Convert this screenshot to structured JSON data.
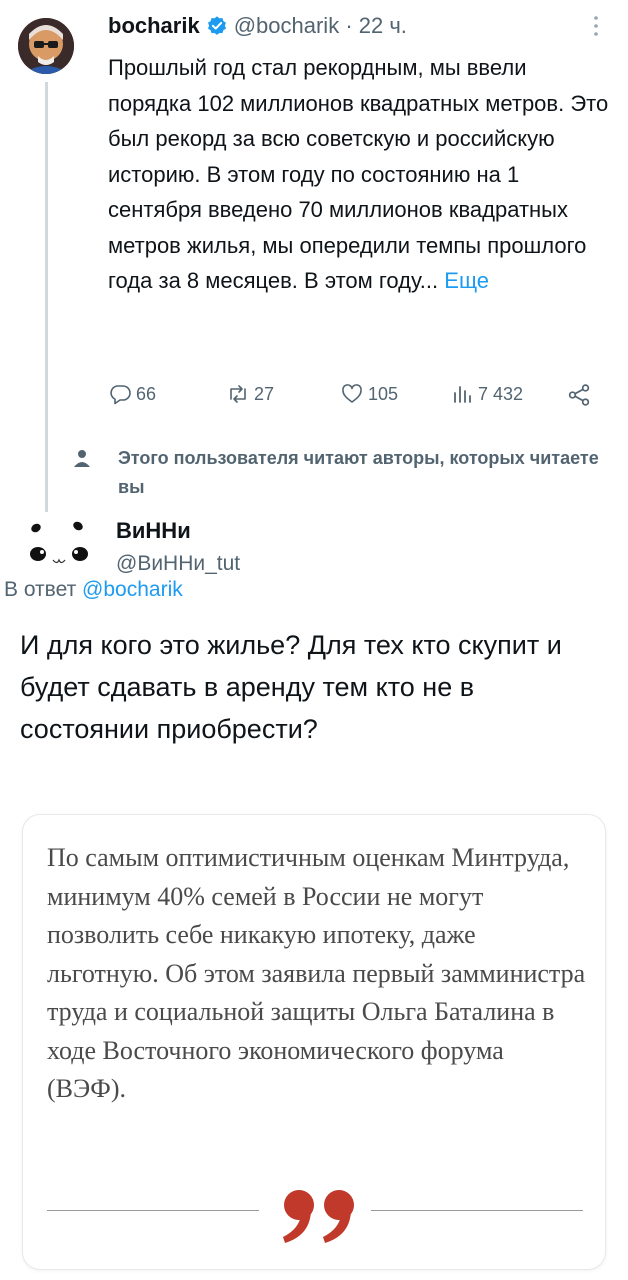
{
  "tweet": {
    "author_name": "bocharik",
    "handle": "@bocharik",
    "separator": " · ",
    "time": "22 ч.",
    "text": "Прошлый год стал рекордным, мы ввели порядка 102 миллионов квадратных метров. Это был рекорд за всю советскую и российскую историю. В этом году по состоянию на 1 сентября введено 70 миллионов квадратных метров жилья, мы опередили темпы прошлого года за 8 месяцев. В этом году...",
    "more_label": "Еще",
    "stats": {
      "replies": "66",
      "retweets": "27",
      "likes": "105",
      "views": "7 432"
    }
  },
  "social_context": "Этого пользователя читают авторы, которых читаете вы",
  "reply": {
    "author_name": "ВиННи",
    "handle": "@ВиННи_tut",
    "reply_prefix": "В ответ ",
    "reply_mention": "@bocharik",
    "text": "И для кого это жилье? Для тех кто скупит и будет сдавать в аренду тем кто не в состоянии приобрести?"
  },
  "quote_card": {
    "text": "По самым оптимистичным оценкам Минтруда, минимум 40% семей в России не могут позволить себе никакую ипотеку, даже льготную. Об этом заявила первый замминистра труда и социальной защиты Ольга Баталина в ходе Восточного экономического форума (ВЭФ).",
    "accent_color": "#c0392b"
  },
  "colors": {
    "link": "#1d9bf0",
    "secondary_text": "#536471",
    "thread_line": "#cfd9de"
  }
}
